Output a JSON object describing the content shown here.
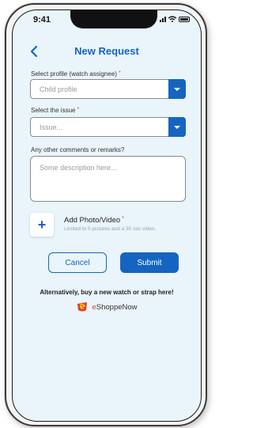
{
  "status_bar": {
    "time": "9:41"
  },
  "header": {
    "title": "New Request"
  },
  "form": {
    "profile": {
      "label": "Select profile (watch assignee)",
      "required_mark": "*",
      "placeholder": "Child profile"
    },
    "issue": {
      "label": "Select the issue",
      "required_mark": "*",
      "placeholder": "Issue..."
    },
    "comments": {
      "label": "Any other comments or remarks?",
      "placeholder": "Some description here..."
    },
    "photo": {
      "title": "Add Photo/Video",
      "required_mark": "*",
      "subtitle": "Limited to 5 pictures and a 30 sec video."
    }
  },
  "actions": {
    "cancel_label": "Cancel",
    "submit_label": "Submit"
  },
  "promo": {
    "text": "Alternatively, buy a new watch or strap here!",
    "brand_e": "e",
    "brand_rest": "ShoppeNow"
  },
  "colors": {
    "accent": "#1565c0",
    "screen_bg": "#e9f4fb",
    "required": "#e53935"
  },
  "icons": {
    "back": "chevron-left-icon",
    "dropdown": "chevron-down-icon",
    "add": "plus-icon",
    "brand": "eshoppenow-logo-icon"
  }
}
